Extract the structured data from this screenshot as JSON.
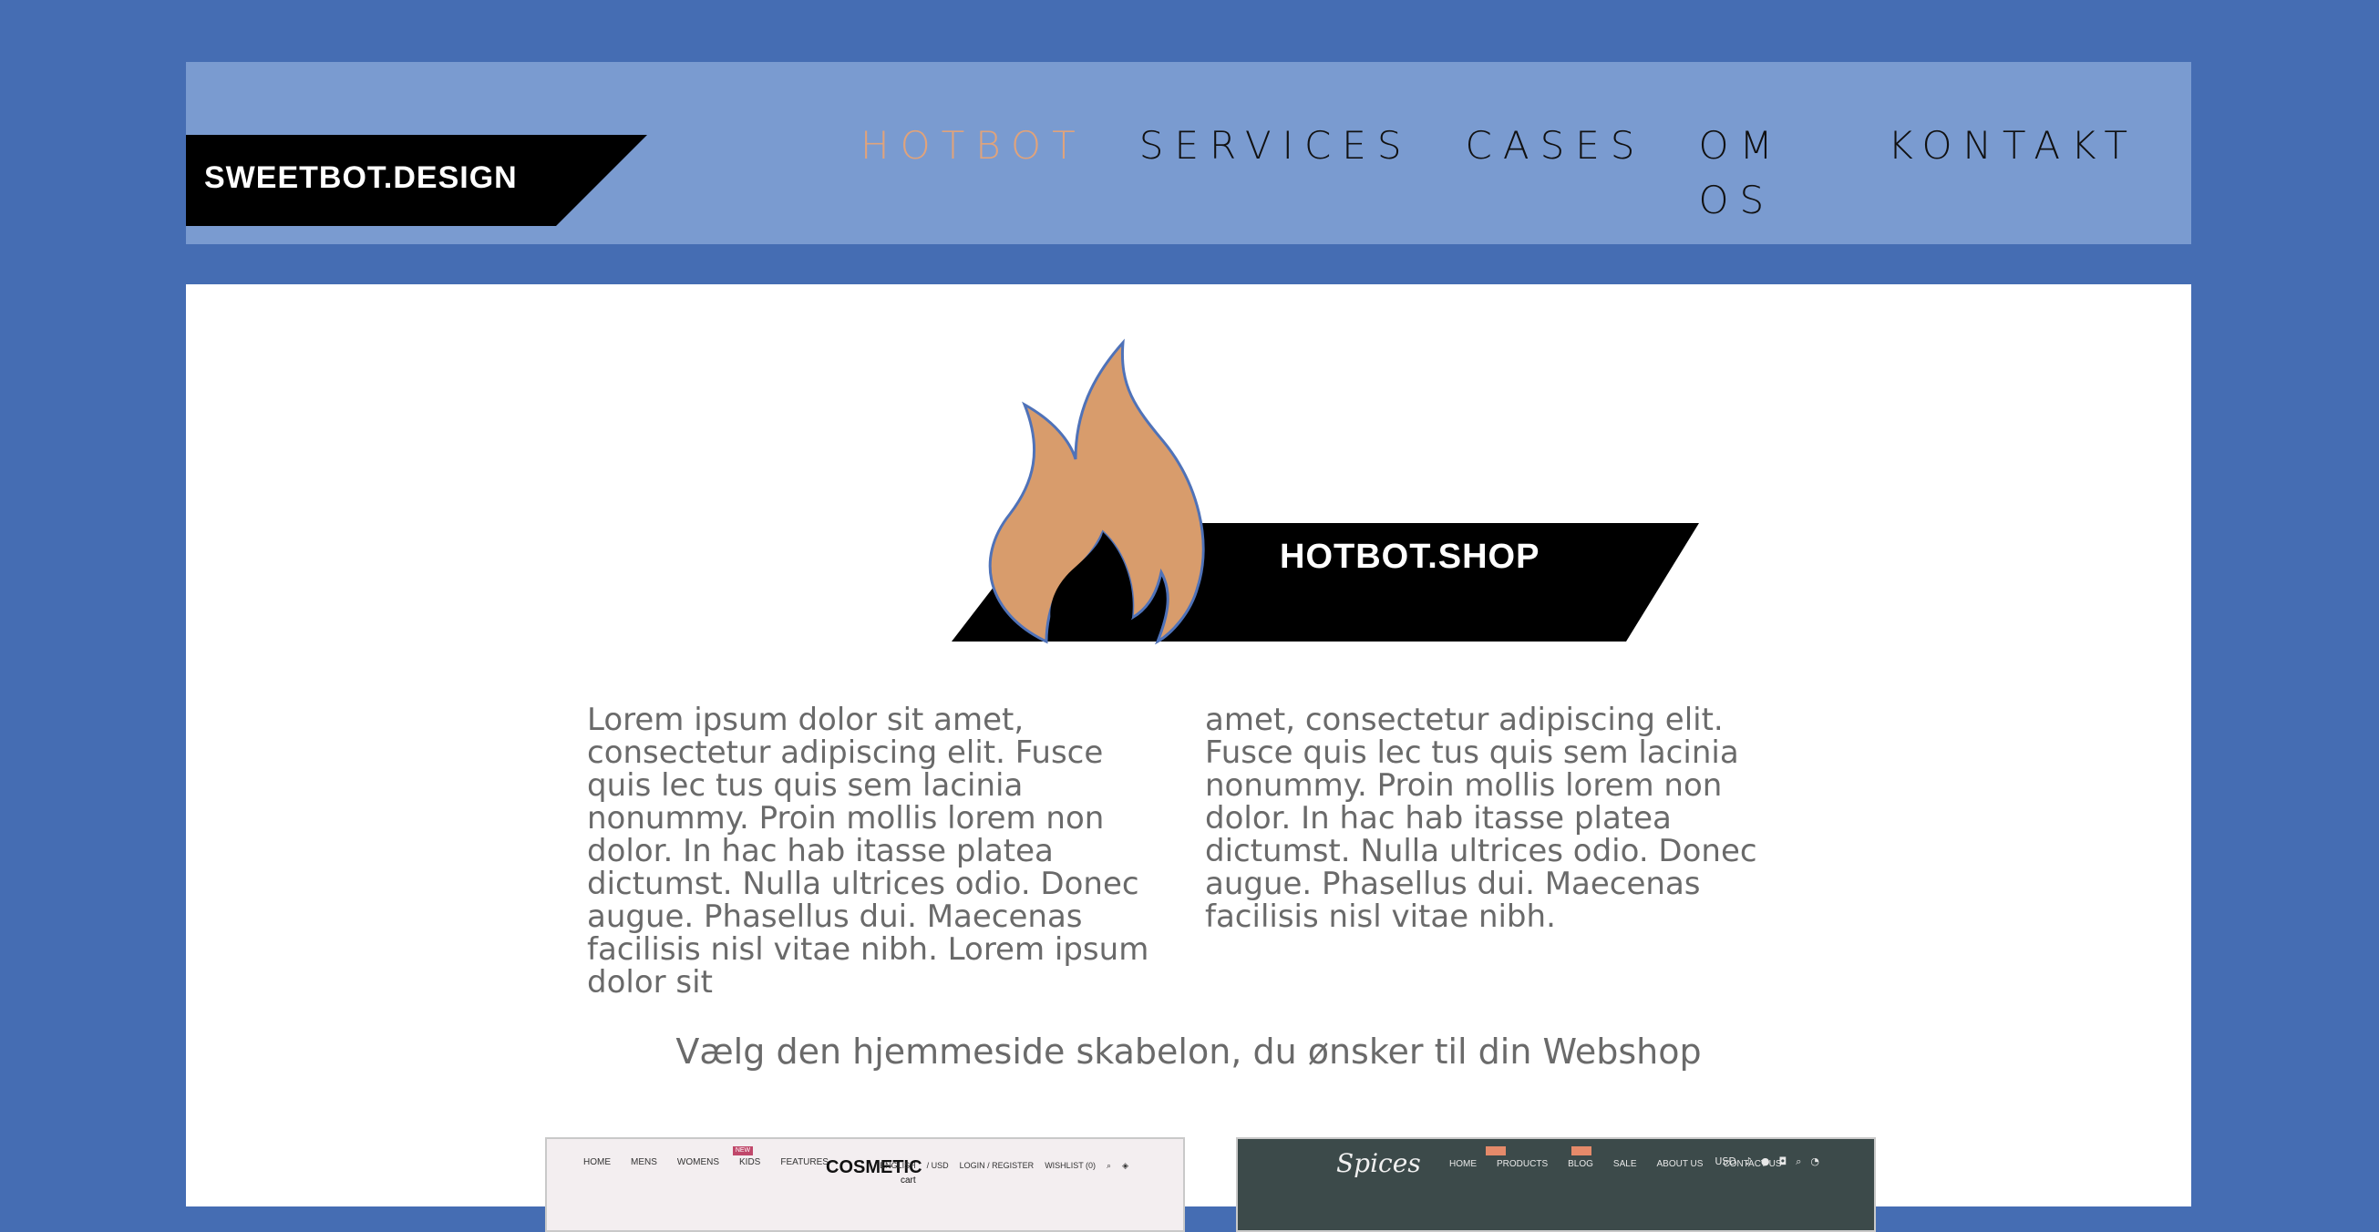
{
  "header": {
    "logo_text": "SWEETBOT.DESIGN",
    "nav": [
      {
        "label": "HOTBOT",
        "active": true
      },
      {
        "label": "SERVICES",
        "active": false
      },
      {
        "label": "CASES",
        "active": false
      },
      {
        "label": "OM OS",
        "active": false
      },
      {
        "label": "KONTAKT",
        "active": false
      }
    ]
  },
  "hero": {
    "logo_text": "HOTBOT.SHOP"
  },
  "body": {
    "col1": "Lorem ipsum dolor sit amet, consectetur adipiscing elit. Fusce quis lec tus quis sem lacinia nonummy. Proin mollis lorem non dolor. In hac hab itasse platea dictumst. Nulla ultrices odio. Donec augue. Phasellus dui. Maecenas facilisis nisl vitae nibh. Lorem ipsum dolor sit",
    "col2": "amet, consectetur adipiscing elit. Fusce quis lec tus quis sem lacinia nonummy. Proin mollis lorem non dolor. In hac hab itasse platea dictumst. Nulla ultrices odio. Donec augue. Phasellus dui. Maecenas facilisis nisl vitae nibh.",
    "subheading": "Vælg den hjemmeside skabelon, du ønsker til din Webshop"
  },
  "thumbnails": [
    {
      "name": "cosmetic",
      "nav": [
        "HOME",
        "MENS",
        "WOMENS",
        "KIDS",
        "FEATURES"
      ],
      "badge": "NEW",
      "brand": "COSMETIC",
      "brand_sub": "cart",
      "right": [
        "ENGLISH",
        "/ USD",
        "LOGIN / REGISTER",
        "WISHLIST (0)"
      ]
    },
    {
      "name": "spices",
      "brand": "Spices",
      "nav": [
        "HOME",
        "PRODUCTS",
        "BLOG",
        "SALE",
        "ABOUT US",
        "CONTACT US"
      ],
      "right": [
        "USD"
      ]
    }
  ],
  "colors": {
    "page_bg": "#456db3",
    "header_bg": "#7a9bd0",
    "nav_active": "#e0a37b",
    "flame": "#d89c6c",
    "text_gray": "#6a6a6a"
  }
}
